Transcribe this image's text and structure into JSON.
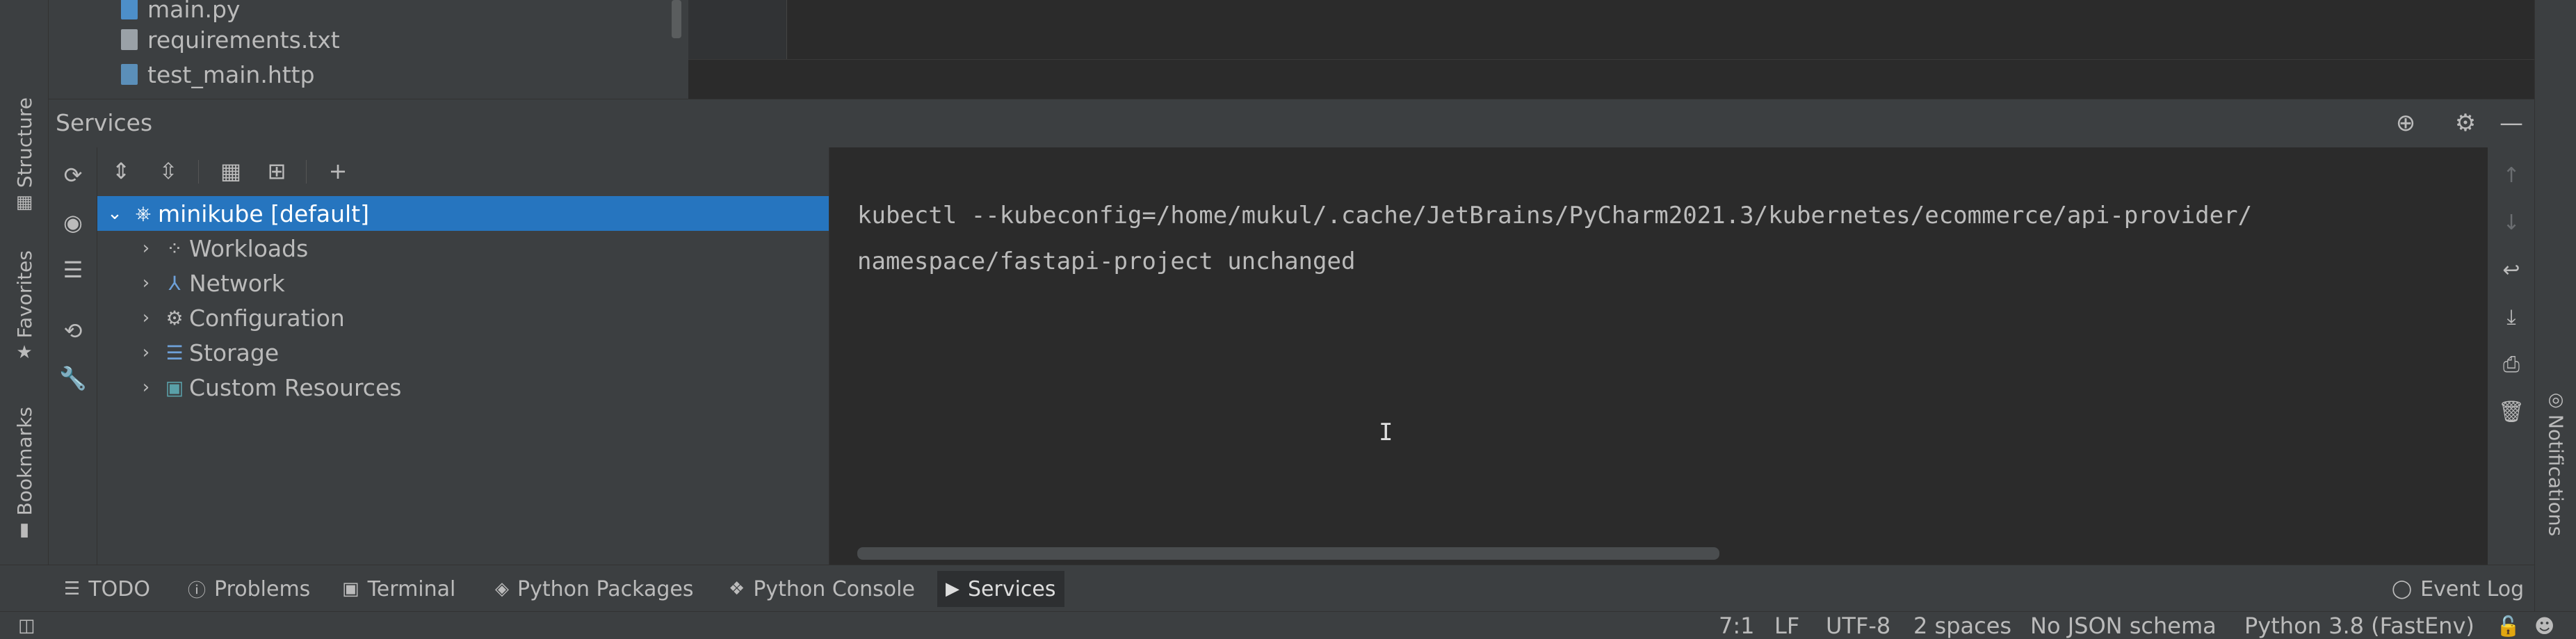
{
  "side_strip": {
    "structure_label": "Structure",
    "favorites_label": "Favorites",
    "bookmarks_label": "Bookmarks"
  },
  "project_tree": {
    "files": [
      "main.py",
      "requirements.txt",
      "test_main.http"
    ]
  },
  "services": {
    "title": "Services",
    "tree": [
      {
        "label": "minikube [default]",
        "icon": "kubernetes-icon",
        "selected": true
      },
      {
        "label": "Workloads",
        "icon": "workloads-icon"
      },
      {
        "label": "Network",
        "icon": "network-icon"
      },
      {
        "label": "Configuration",
        "icon": "gear-icon"
      },
      {
        "label": "Storage",
        "icon": "database-icon"
      },
      {
        "label": "Custom Resources",
        "icon": "custom-resources-icon"
      }
    ]
  },
  "console": {
    "lines": [
      "kubectl --kubeconfig=/home/mukul/.cache/JetBrains/PyCharm2021.3/kubernetes/ecommerce/api-provider/",
      "namespace/fastapi-project unchanged"
    ]
  },
  "notifications_label": "Notifications",
  "tool_tabs": [
    {
      "label": "TODO",
      "icon": "list-icon"
    },
    {
      "label": "Problems",
      "icon": "warning-icon"
    },
    {
      "label": "Terminal",
      "icon": "terminal-icon"
    },
    {
      "label": "Python Packages",
      "icon": "packages-icon"
    },
    {
      "label": "Python Console",
      "icon": "python-icon"
    },
    {
      "label": "Services",
      "icon": "services-icon",
      "active": true
    }
  ],
  "event_log_label": "Event Log",
  "status_bar": {
    "position": "7:1",
    "line_separator": "LF",
    "encoding": "UTF-8",
    "indent": "2 spaces",
    "json_schema": "No JSON schema",
    "interpreter": "Python 3.8 (FastEnv)"
  },
  "colors": {
    "selection": "#2675bf",
    "panel": "#3c3f41",
    "editor": "#2b2b2b"
  }
}
